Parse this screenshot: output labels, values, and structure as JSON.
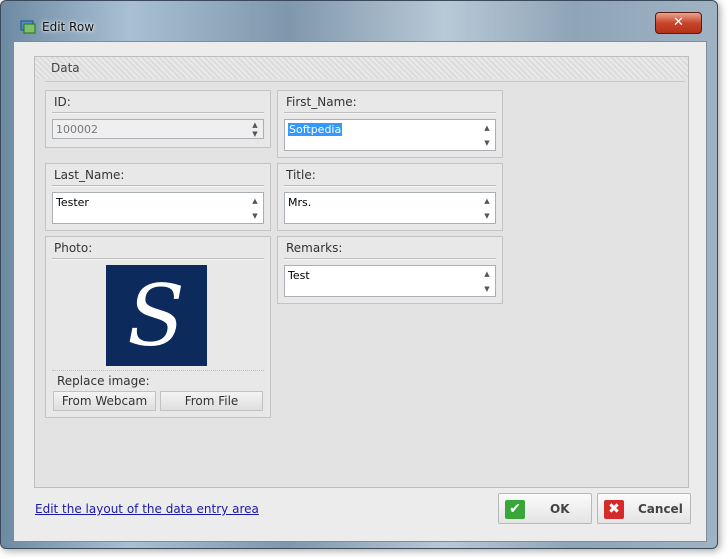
{
  "window": {
    "title": "Edit Row",
    "close_glyph": "✕"
  },
  "group": {
    "title": "Data"
  },
  "fields": {
    "id": {
      "label": "ID:",
      "value": "100002"
    },
    "first_name": {
      "label": "First_Name:",
      "value": "Softpedia"
    },
    "last_name": {
      "label": "Last_Name:",
      "value": "Tester"
    },
    "title": {
      "label": "Title:",
      "value": "Mrs."
    },
    "photo": {
      "label": "Photo:"
    },
    "remarks": {
      "label": "Remarks:",
      "value": "Test"
    }
  },
  "photo_panel": {
    "replace_label": "Replace image:",
    "from_webcam": "From Webcam",
    "from_file": "From File"
  },
  "footer": {
    "edit_layout_link": "Edit the layout of the data entry area",
    "ok_label": "OK",
    "cancel_label": "Cancel"
  },
  "icons": {
    "spin_up": "▲",
    "spin_down": "▼",
    "ok_icon": "✔",
    "cancel_icon": "✖"
  },
  "colors": {
    "ok_icon": "#3aa63a",
    "cancel_icon": "#d42a2a",
    "photo_bg": "#0c2a5c",
    "selection": "#3399ff",
    "link": "#1a1aa8"
  }
}
